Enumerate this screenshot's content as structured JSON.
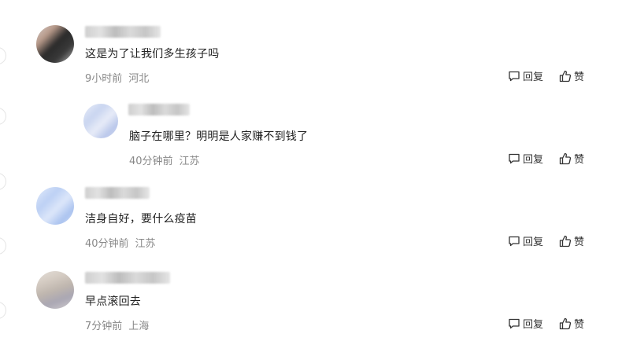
{
  "comments": [
    {
      "text": "这是为了让我们多生孩子吗",
      "time": "9小时前",
      "location": "河北",
      "reply_label": "回复",
      "like_label": "赞"
    },
    {
      "text": "脑子在哪里？明明是人家赚不到钱了",
      "time": "40分钟前",
      "location": "江苏",
      "reply_label": "回复",
      "like_label": "赞"
    },
    {
      "text": "洁身自好，要什么疫苗",
      "time": "40分钟前",
      "location": "江苏",
      "reply_label": "回复",
      "like_label": "赞"
    },
    {
      "text": "早点滚回去",
      "time": "7分钟前",
      "location": "上海",
      "reply_label": "回复",
      "like_label": "赞"
    }
  ]
}
